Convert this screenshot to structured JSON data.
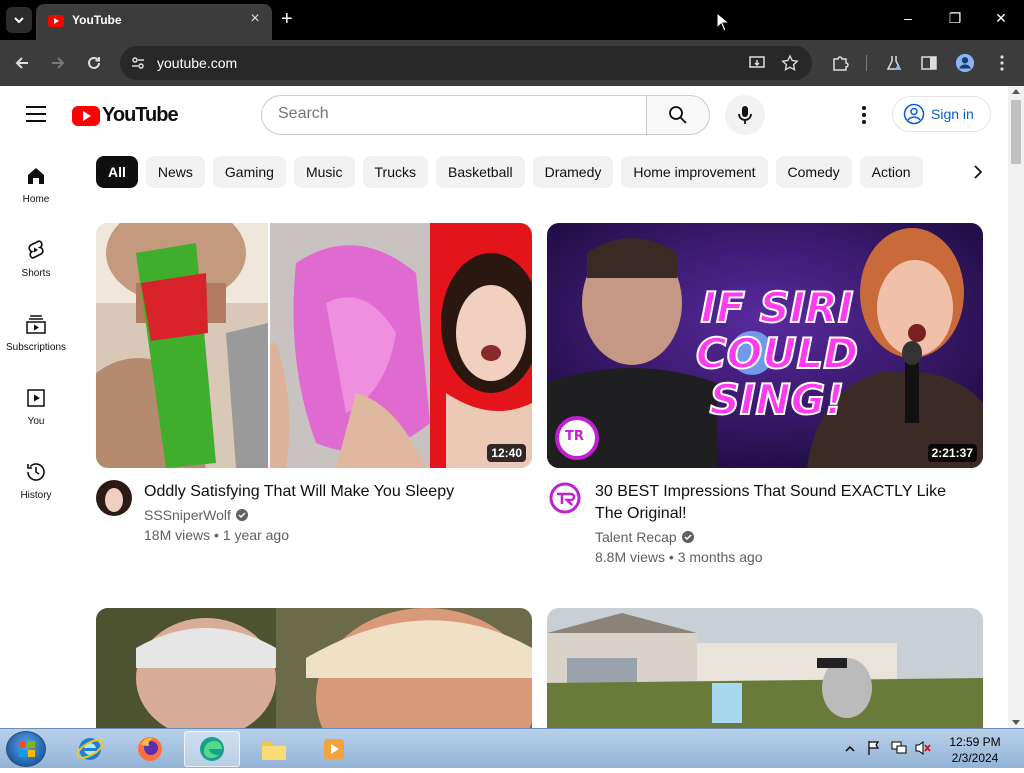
{
  "browser": {
    "tab_title": "YouTube",
    "url": "youtube.com"
  },
  "youtube": {
    "logo_text": "YouTube",
    "search_placeholder": "Search",
    "sign_in": "Sign in",
    "sidebar": [
      {
        "label": "Home",
        "icon": "home-icon"
      },
      {
        "label": "Shorts",
        "icon": "shorts-icon"
      },
      {
        "label": "Subscriptions",
        "icon": "subscriptions-icon"
      },
      {
        "label": "You",
        "icon": "you-icon"
      },
      {
        "label": "History",
        "icon": "history-icon"
      }
    ],
    "chips": [
      "All",
      "News",
      "Gaming",
      "Music",
      "Trucks",
      "Basketball",
      "Dramedy",
      "Home improvement",
      "Comedy",
      "Action"
    ],
    "videos": [
      {
        "title": "Oddly Satisfying That Will Make You Sleepy",
        "channel": "SSSniperWolf",
        "views": "18M views",
        "age": "1 year ago",
        "duration": "12:40"
      },
      {
        "title": "30 BEST Impressions That Sound EXACTLY Like The Original!",
        "channel": "Talent Recap",
        "views": "8.8M views",
        "age": "3 months ago",
        "duration": "2:21:37",
        "thumb_text_1": "IF SIRI",
        "thumb_text_2": "COULD",
        "thumb_text_3": "SING!",
        "badge": "TR"
      }
    ]
  },
  "taskbar": {
    "time": "12:59 PM",
    "date": "2/3/2024"
  }
}
